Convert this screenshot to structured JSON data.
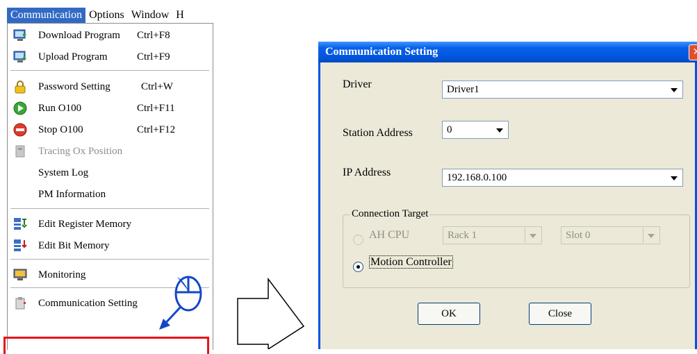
{
  "menubar": {
    "items": [
      {
        "label": "Communication"
      },
      {
        "label": "Options"
      },
      {
        "label": "Window"
      },
      {
        "label": "H"
      }
    ]
  },
  "menu": {
    "items": [
      {
        "label": "Download Program",
        "shortcut": "Ctrl+F8",
        "icon": "download-icon"
      },
      {
        "label": "Upload Program",
        "shortcut": "Ctrl+F9",
        "icon": "upload-icon"
      },
      {
        "label": "Password Setting",
        "shortcut": "Ctrl+W",
        "icon": "lock-icon"
      },
      {
        "label": "Run O100",
        "shortcut": "Ctrl+F11",
        "icon": "run-icon"
      },
      {
        "label": "Stop O100",
        "shortcut": "Ctrl+F12",
        "icon": "stop-icon"
      },
      {
        "label": "Tracing Ox Position",
        "shortcut": "",
        "icon": "trace-icon",
        "disabled": true
      },
      {
        "label": "System Log",
        "shortcut": ""
      },
      {
        "label": "PM Information",
        "shortcut": ""
      },
      {
        "label": "Edit Register Memory",
        "shortcut": "",
        "icon": "edit-register-icon"
      },
      {
        "label": "Edit Bit Memory",
        "shortcut": "",
        "icon": "edit-bit-icon"
      },
      {
        "label": "Monitoring",
        "shortcut": "",
        "icon": "monitor-icon"
      },
      {
        "label": "Communication Setting",
        "shortcut": "",
        "icon": "communication-setting-icon"
      }
    ]
  },
  "dialog": {
    "title": "Communication Setting",
    "driver_label": "Driver",
    "driver_value": "Driver1",
    "station_label": "Station Address",
    "station_value": "0",
    "ip_label": "IP Address",
    "ip_value": "192.168.0.100",
    "group_label": "Connection Target",
    "ahcpu_label": "AH CPU",
    "rack_value": "Rack 1",
    "slot_value": "Slot 0",
    "motion_label": "Motion Controller",
    "ok_label": "OK",
    "close_label": "Close"
  }
}
